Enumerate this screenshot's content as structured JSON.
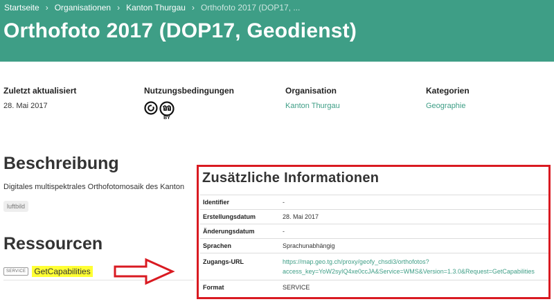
{
  "breadcrumb": {
    "items": [
      "Startseite",
      "Organisationen",
      "Kanton Thurgau"
    ],
    "current": "Orthofoto 2017 (DOP17, ..."
  },
  "page": {
    "title": "Orthofoto 2017 (DOP17, Geodienst)"
  },
  "meta": {
    "last_updated": {
      "label": "Zuletzt aktualisiert",
      "value": "28. Mai 2017"
    },
    "terms": {
      "label": "Nutzungsbedingungen",
      "badge_text": "BY",
      "icons": [
        "cc-open-icon",
        "cc-attribution-icon"
      ]
    },
    "organisation": {
      "label": "Organisation",
      "value": "Kanton Thurgau"
    },
    "categories": {
      "label": "Kategorien",
      "value": "Geographie"
    }
  },
  "description": {
    "title": "Beschreibung",
    "text": "Digitales multispektrales Orthofotomosaik des Kanton",
    "tag": "luftbild"
  },
  "resources": {
    "title": "Ressourcen",
    "items": [
      {
        "format": "SERVICE",
        "name": "GetCapabilities"
      }
    ]
  },
  "additional_info": {
    "title": "Zusätzliche Informationen",
    "rows": [
      {
        "key": "Identifier",
        "value": "-"
      },
      {
        "key": "Erstellungsdatum",
        "value": "28. Mai 2017"
      },
      {
        "key": "Änderungsdatum",
        "value": "-"
      },
      {
        "key": "Sprachen",
        "value": "Sprachunabhängig"
      },
      {
        "key": "Zugangs-URL",
        "value_line1": "https://map.geo.tg.ch/proxy/geofy_chsdi3/orthofotos?",
        "value_line2": "access_key=YoW2syIQ4xe0ccJA&Service=WMS&Version=1.3.0&Request=GetCapabilities"
      },
      {
        "key": "Format",
        "value": "SERVICE"
      }
    ]
  },
  "colors": {
    "brand": "#3e9e86",
    "annotation": "#d91a21",
    "highlight": "#ffff33"
  }
}
